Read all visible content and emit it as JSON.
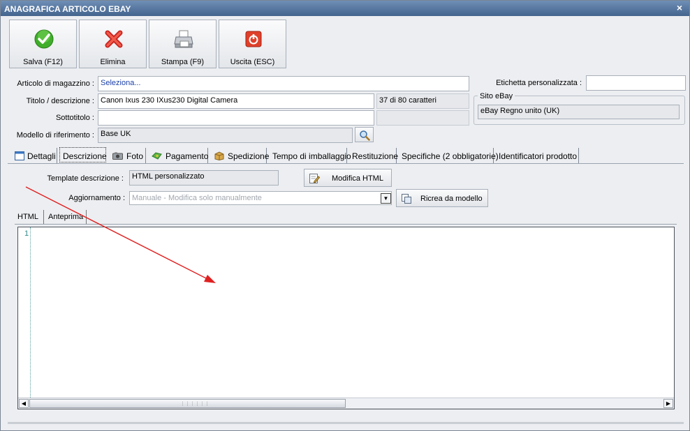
{
  "window": {
    "title": "ANAGRAFICA ARTICOLO EBAY",
    "close_glyph": "×"
  },
  "toolbar": {
    "save": "Salva (F12)",
    "delete": "Elimina",
    "print": "Stampa (F9)",
    "exit": "Uscita (ESC)"
  },
  "form": {
    "articolo_label": "Articolo di magazzino :",
    "articolo_value": "Seleziona...",
    "titolo_label": "Titolo / descrizione :",
    "titolo_value": "Canon Ixus 230 IXus230 Digital Camera",
    "char_count": "37 di 80 caratteri",
    "sottotitolo_label": "Sottotitolo :",
    "sottotitolo_value": "",
    "modello_label": "Modello di riferimento :",
    "modello_value": "Base UK",
    "etichetta_label": "Etichetta personalizzata :",
    "etichetta_value": "",
    "sito_label": "Sito eBay",
    "sito_value": "eBay Regno unito (UK)"
  },
  "tabs": [
    {
      "label": "Dettagli"
    },
    {
      "label": "Descrizione"
    },
    {
      "label": "Foto"
    },
    {
      "label": "Pagamento"
    },
    {
      "label": "Spedizione"
    },
    {
      "label": "Tempo di imballaggio"
    },
    {
      "label": "Restituzione"
    },
    {
      "label": "Specifiche (2 obbligatorie)"
    },
    {
      "label": "Identificatori prodotto"
    }
  ],
  "descrizione": {
    "template_label": "Template descrizione :",
    "template_value": "HTML personalizzato",
    "modifica_html": "Modifica HTML",
    "aggiornamento_label": "Aggiornamento :",
    "aggiornamento_value": "Manuale - Modifica solo manualmente",
    "ricrea": "Ricrea da modello"
  },
  "subtabs": [
    {
      "label": "HTML"
    },
    {
      "label": "Anteprima"
    }
  ],
  "editor": {
    "line_number": "1"
  },
  "colors": {
    "titlebar": "#4d6e98",
    "annotation_arrow": "#e02020"
  }
}
